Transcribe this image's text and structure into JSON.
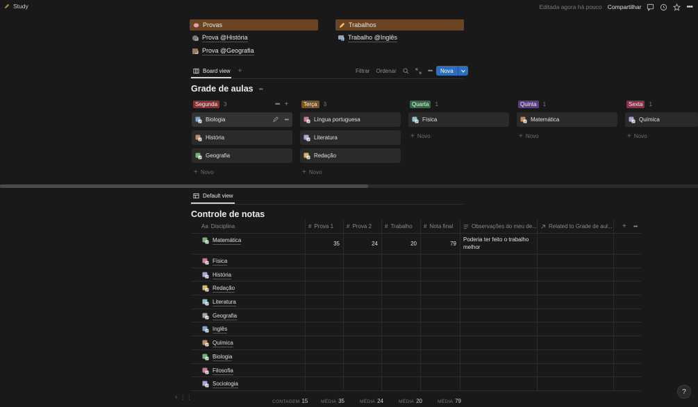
{
  "topbar": {
    "breadcrumb": "Study",
    "edited": "Editada agora há pouco",
    "share": "Compartilhar"
  },
  "links": {
    "provas": {
      "title": "Provas",
      "items": [
        "Prova @História",
        "Prova @Geografia"
      ]
    },
    "trabalhos": {
      "title": "Trabalhos",
      "items": [
        "Trabalho @Inglês"
      ]
    }
  },
  "board": {
    "view_tab": "Board view",
    "toolbar": {
      "filter": "Filtrar",
      "sort": "Ordenar",
      "new": "Nova"
    },
    "title": "Grade de aulas",
    "add_new": "Novo",
    "columns": [
      {
        "name": "Segunda",
        "count": "3",
        "color": "#8a2f2f",
        "cards": [
          "Biologia",
          "História",
          "Geografia"
        ]
      },
      {
        "name": "Terça",
        "count": "3",
        "color": "#7a5320",
        "cards": [
          "Língua portuguesa",
          "Literatura",
          "Redação"
        ]
      },
      {
        "name": "Quarta",
        "count": "1",
        "color": "#2d6b45",
        "cards": [
          "Física"
        ]
      },
      {
        "name": "Quinta",
        "count": "1",
        "color": "#5d3b86",
        "cards": [
          "Matemática"
        ]
      },
      {
        "name": "Sexta",
        "count": "1",
        "color": "#8a2f48",
        "cards": [
          "Química"
        ]
      }
    ]
  },
  "table": {
    "view_tab": "Default view",
    "title": "Controle de notas",
    "columns": {
      "disciplina": "Disciplina",
      "disciplina_prefix": "Aa",
      "prova1": "Prova 1",
      "prova2": "Prova 2",
      "trabalho": "Trabalho",
      "nota_final": "Nota final",
      "observacoes": "Observações do meu de...",
      "related": "Related to Grade de aul..."
    },
    "rows": [
      {
        "name": "Matemática",
        "p1": "35",
        "p2": "24",
        "t": "20",
        "nf": "79",
        "obs": "Poderia ter feito o trabalho melhor"
      },
      {
        "name": "Física",
        "p1": "",
        "p2": "",
        "t": "",
        "nf": "",
        "obs": ""
      },
      {
        "name": "História",
        "p1": "",
        "p2": "",
        "t": "",
        "nf": "",
        "obs": ""
      },
      {
        "name": "Redação",
        "p1": "",
        "p2": "",
        "t": "",
        "nf": "",
        "obs": ""
      },
      {
        "name": "Literatura",
        "p1": "",
        "p2": "",
        "t": "",
        "nf": "",
        "obs": ""
      },
      {
        "name": "Geografia",
        "p1": "",
        "p2": "",
        "t": "",
        "nf": "",
        "obs": ""
      },
      {
        "name": "Inglês",
        "p1": "",
        "p2": "",
        "t": "",
        "nf": "",
        "obs": ""
      },
      {
        "name": "Química",
        "p1": "",
        "p2": "",
        "t": "",
        "nf": "",
        "obs": ""
      },
      {
        "name": "Biologia",
        "p1": "",
        "p2": "",
        "t": "",
        "nf": "",
        "obs": ""
      },
      {
        "name": "Filosofia",
        "p1": "",
        "p2": "",
        "t": "",
        "nf": "",
        "obs": ""
      },
      {
        "name": "Sociologia",
        "p1": "",
        "p2": "",
        "t": "",
        "nf": "",
        "obs": ""
      }
    ],
    "footer": {
      "count_label": "CONTAGEM",
      "count": "15",
      "avg_label": "MÉDIA",
      "avg_p1": "35",
      "avg_p2": "24",
      "avg_t": "20",
      "avg_nf": "79"
    }
  },
  "help": "?"
}
